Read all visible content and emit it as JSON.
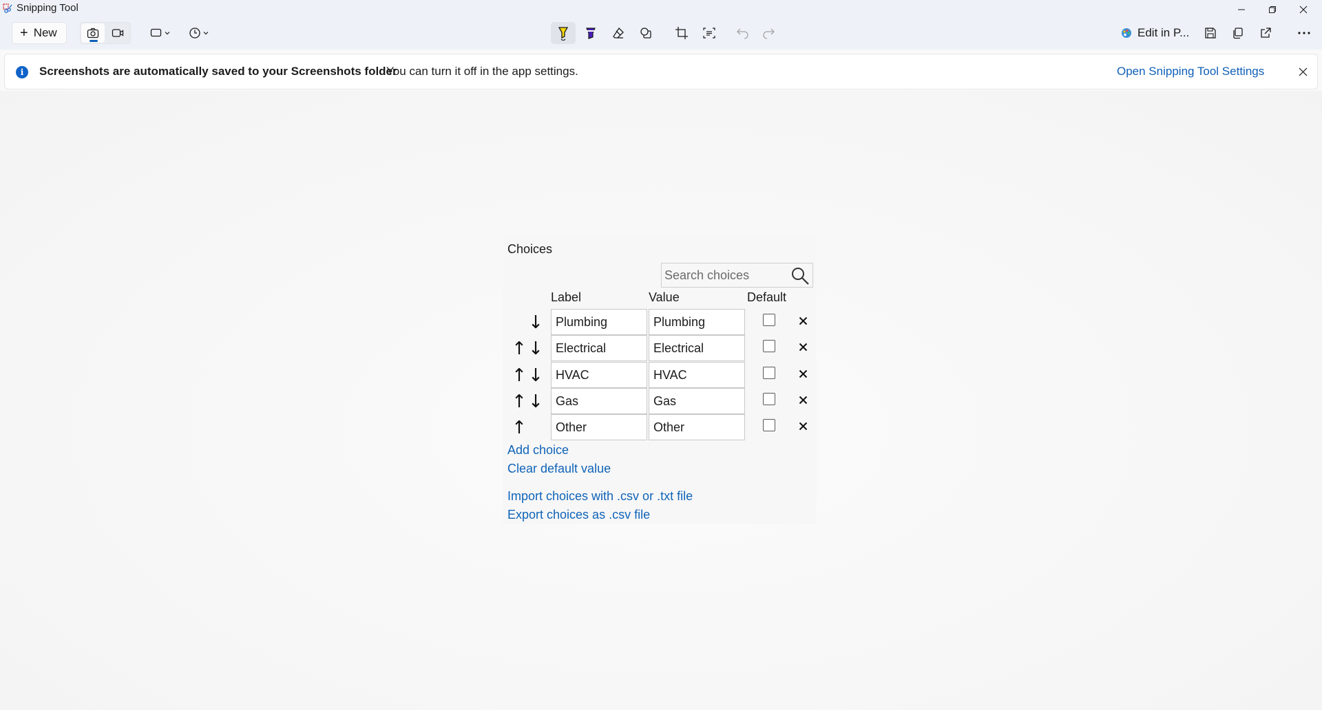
{
  "window": {
    "title": "Snipping Tool"
  },
  "toolbar": {
    "new_label": "New",
    "edit_in_label": "Edit in P..."
  },
  "infobar": {
    "title": "Screenshots are automatically saved to your Screenshots folder",
    "message": "You can turn it off in the app settings.",
    "link": "Open Snipping Tool Settings"
  },
  "choices": {
    "title": "Choices",
    "search_placeholder": "Search choices",
    "headers": {
      "label": "Label",
      "value": "Value",
      "default": "Default"
    },
    "rows": [
      {
        "label": "Plumbing",
        "value": "Plumbing",
        "default": false,
        "up": false,
        "down": true
      },
      {
        "label": "Electrical",
        "value": "Electrical",
        "default": false,
        "up": true,
        "down": true
      },
      {
        "label": "HVAC",
        "value": "HVAC",
        "default": false,
        "up": true,
        "down": true
      },
      {
        "label": "Gas",
        "value": "Gas",
        "default": false,
        "up": true,
        "down": true
      },
      {
        "label": "Other",
        "value": "Other",
        "default": false,
        "up": true,
        "down": false
      }
    ],
    "arrow_up": "↑",
    "arrow_down": "↓",
    "add_choice": "Add choice",
    "clear_default": "Clear default value",
    "import_link": "Import choices with .csv or .txt file",
    "export_link": "Export choices as .csv file"
  },
  "colors": {
    "accent": "#0f63b8",
    "titlebar_bg": "#eef2f8"
  }
}
